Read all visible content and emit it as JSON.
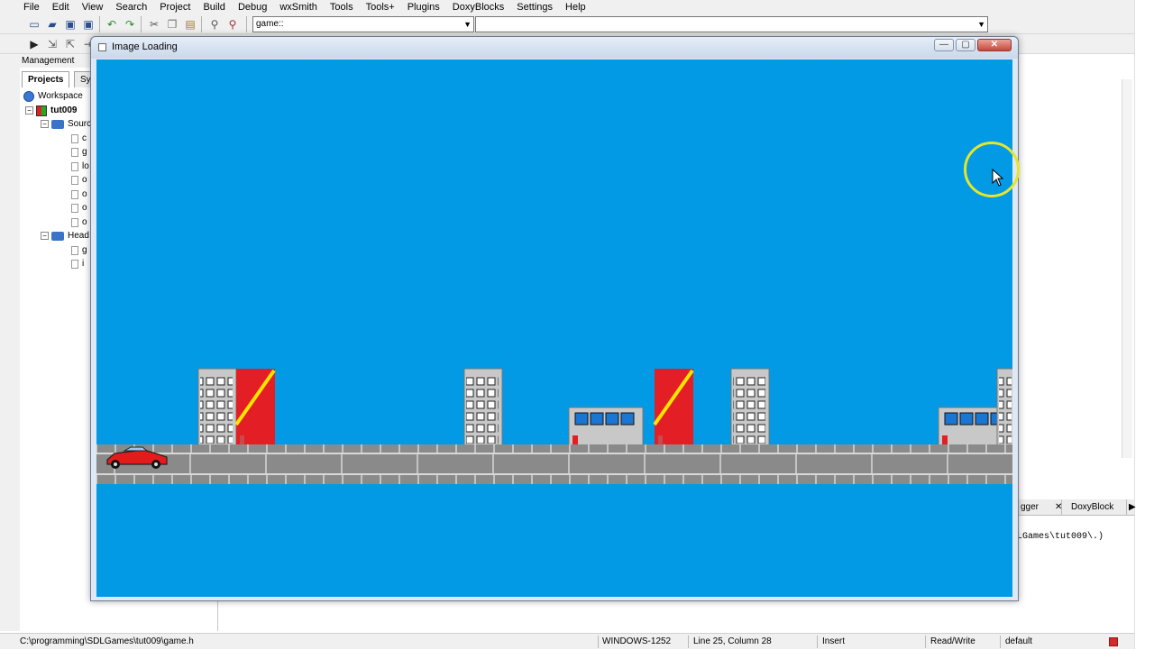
{
  "menubar": {
    "items": [
      "File",
      "Edit",
      "View",
      "Search",
      "Project",
      "Build",
      "Debug",
      "wxSmith",
      "Tools",
      "Tools+",
      "Plugins",
      "DoxyBlocks",
      "Settings",
      "Help"
    ]
  },
  "toolbar": {
    "scope_combo": "game::",
    "function_combo": ""
  },
  "management": {
    "title": "Management",
    "tab_projects": "Projects",
    "tab_symbols": "Sy",
    "workspace_label": "Workspace",
    "project_name": "tut009",
    "sources_label": "Sourc",
    "source_files": [
      "c",
      "g",
      "lo",
      "o",
      "o",
      "o",
      "o"
    ],
    "headers_label": "Head",
    "header_files": [
      "g",
      "i"
    ]
  },
  "game_window": {
    "title": "Image Loading",
    "minimize_label": "—",
    "maximize_label": "▢",
    "close_label": "✕"
  },
  "log_panel": {
    "tab_debugger": "gger",
    "tab_doxyblocks": "DoxyBlock",
    "log_line": "LGames\\tut009\\.)"
  },
  "statusbar": {
    "file_path": "C:\\programming\\SDLGames\\tut009\\game.h",
    "encoding": "WINDOWS-1252",
    "position": "Line 25, Column 28",
    "mode": "Insert",
    "access": "Read/Write",
    "language": "default"
  },
  "colors": {
    "sky": "#0299e5",
    "road_gray": "#8a8a8a",
    "building_gray": "#c8c8c8",
    "red_tower": "#e31e24",
    "stripe_yellow": "#ffe500",
    "window_blue": "#1976d2",
    "car_red": "#e41b1b",
    "cursor_highlight": "#e5e62a"
  },
  "icons": {
    "run": "run-icon",
    "new_file": "new-file-icon",
    "open": "open-folder-icon",
    "save": "save-icon",
    "undo": "undo-icon",
    "redo": "redo-icon",
    "cut": "cut-icon",
    "copy": "copy-icon",
    "paste": "paste-icon",
    "find": "find-icon",
    "replace": "replace-icon"
  }
}
